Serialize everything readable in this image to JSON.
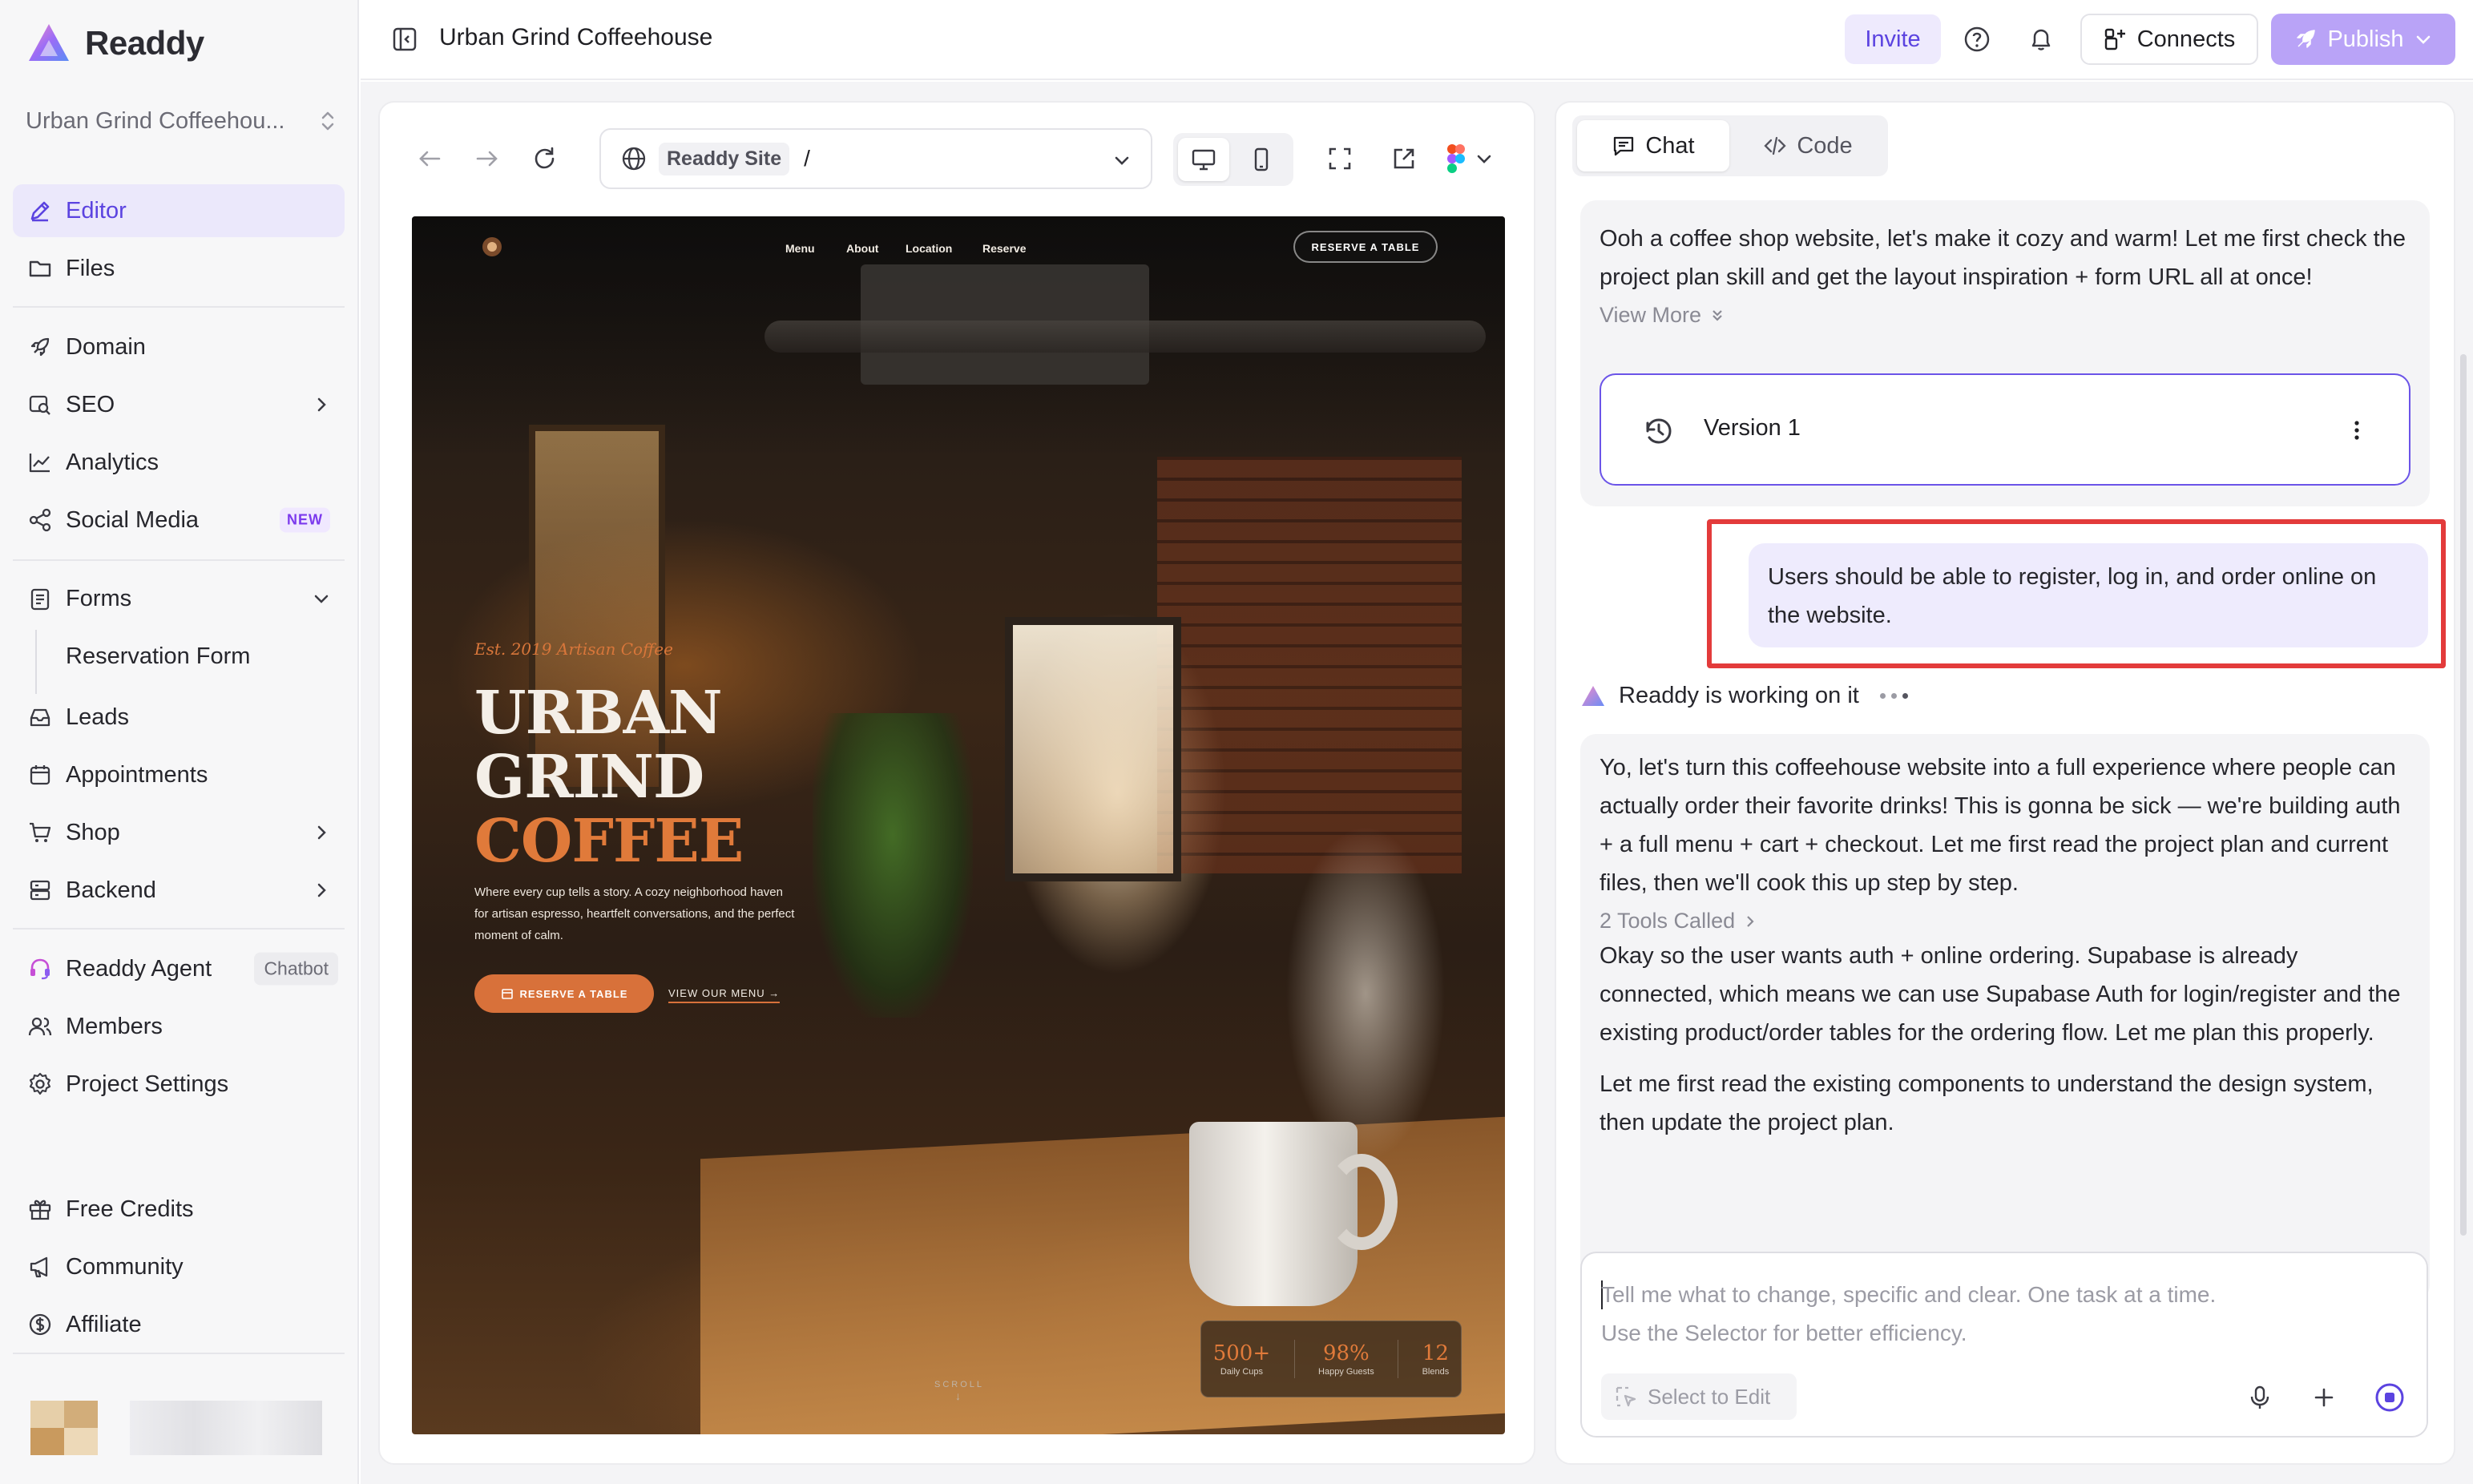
{
  "app": {
    "name": "Readdy"
  },
  "sidebar": {
    "project_name": "Urban Grind Coffeehou...",
    "items": [
      {
        "label": "Editor"
      },
      {
        "label": "Files"
      },
      {
        "label": "Domain"
      },
      {
        "label": "SEO"
      },
      {
        "label": "Analytics"
      },
      {
        "label": "Social Media",
        "badge": "NEW"
      },
      {
        "label": "Forms"
      },
      {
        "label": "Reservation Form"
      },
      {
        "label": "Leads"
      },
      {
        "label": "Appointments"
      },
      {
        "label": "Shop"
      },
      {
        "label": "Backend"
      },
      {
        "label": "Readdy Agent",
        "badge": "Chatbot"
      },
      {
        "label": "Members"
      },
      {
        "label": "Project Settings"
      },
      {
        "label": "Free Credits"
      },
      {
        "label": "Community"
      },
      {
        "label": "Affiliate"
      }
    ]
  },
  "topbar": {
    "title": "Urban Grind Coffeehouse",
    "invite": "Invite",
    "connects": "Connects",
    "publish": "Publish"
  },
  "preview": {
    "site_chip": "Readdy Site",
    "path": "/",
    "site": {
      "nav": [
        "Menu",
        "About",
        "Location",
        "Reserve"
      ],
      "cta_top": "RESERVE A TABLE",
      "kicker": "Est. 2019 Artisan Coffee",
      "h1_line1": "URBAN",
      "h1_line2": "GRIND",
      "h1_line3": "COFFEE",
      "description": "Where every cup tells a story. A cozy neighborhood haven for artisan espresso, heartfelt conversations, and the perfect moment of calm.",
      "primary_button": "RESERVE A TABLE",
      "secondary_link": "VIEW OUR MENU",
      "scroll": "SCROLL",
      "stats": [
        {
          "value": "500+",
          "label": "Daily Cups"
        },
        {
          "value": "98%",
          "label": "Happy Guests"
        },
        {
          "value": "12",
          "label": "Blends"
        }
      ]
    }
  },
  "chat": {
    "tabs": {
      "chat": "Chat",
      "code": "Code"
    },
    "msg1": "Ooh a coffee shop website, let's make it cozy and warm! Let me first check the project plan skill and get the layout inspiration + form URL all at once!",
    "view_more": "View More",
    "version": "Version 1",
    "user_message": "Users should be able to register, log in, and order online on the website.",
    "working": "Readdy is working on it",
    "msg2_p1": "Yo, let's turn this coffeehouse website into a full experience where people can actually order their favorite drinks! This is gonna be sick — we're building auth + a full menu + cart + checkout. Let me first read the project plan and current files, then we'll cook this up step by step.",
    "tools_called": "2 Tools Called",
    "msg2_p2": "Okay so the user wants auth + online ordering. Supabase is already connected, which means we can use Supabase Auth for login/register and the existing product/order tables for the ordering flow. Let me plan this properly.",
    "msg2_p3": "Let me first read the existing components to understand the design system, then update the project plan.",
    "composer_placeholder_1": "Tell me what to change, specific and clear. One task at a time.",
    "composer_placeholder_2": "Use the Selector for better efficiency.",
    "select_to_edit": "Select to Edit"
  },
  "colors": {
    "accent": "#5b43e0",
    "publish": "#b9a3f7",
    "highlight": "#e33b3b",
    "coffee_accent": "#e07a3a"
  }
}
